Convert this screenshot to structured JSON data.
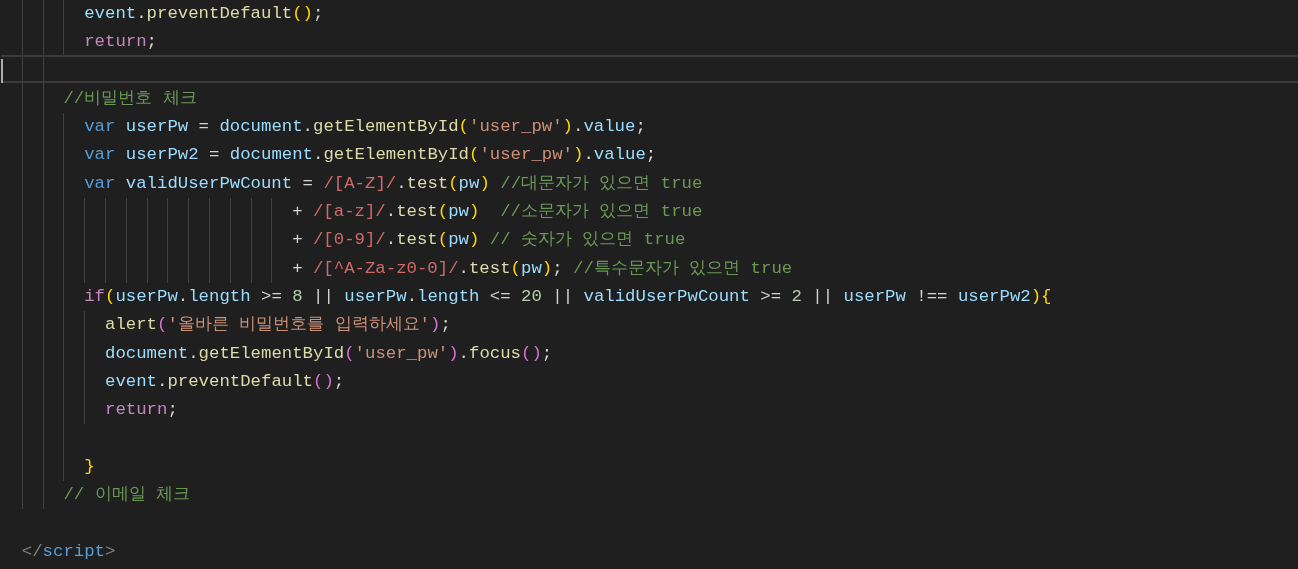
{
  "editor": {
    "lines": [
      {
        "current": false,
        "tokens": [
          {
            "text": "        event",
            "kind": "variable"
          },
          {
            "text": ".",
            "kind": "plain"
          },
          {
            "text": "preventDefault",
            "kind": "function"
          },
          {
            "text": "()",
            "kind": "bracket"
          },
          {
            "text": ";",
            "kind": "plain"
          }
        ]
      },
      {
        "current": false,
        "tokens": [
          {
            "text": "        return",
            "kind": "control"
          },
          {
            "text": ";",
            "kind": "plain"
          }
        ]
      },
      {
        "current": true
      },
      {
        "current": false,
        "tokens": [
          {
            "text": "      //비밀번호 체크",
            "kind": "comment"
          }
        ]
      },
      {
        "current": false,
        "tokens": [
          {
            "text": "        var",
            "kind": "keyword"
          },
          {
            "text": " userPw ",
            "kind": "variable"
          },
          {
            "text": "= ",
            "kind": "plain"
          },
          {
            "text": "document",
            "kind": "variable"
          },
          {
            "text": ".",
            "kind": "plain"
          },
          {
            "text": "getElementById",
            "kind": "function"
          },
          {
            "text": "(",
            "kind": "bracket"
          },
          {
            "text": "'user_pw'",
            "kind": "string"
          },
          {
            "text": ")",
            "kind": "bracket"
          },
          {
            "text": ".",
            "kind": "plain"
          },
          {
            "text": "value",
            "kind": "variable"
          },
          {
            "text": ";",
            "kind": "plain"
          }
        ]
      },
      {
        "current": false,
        "tokens": [
          {
            "text": "        var",
            "kind": "keyword"
          },
          {
            "text": " userPw2 ",
            "kind": "variable"
          },
          {
            "text": "= ",
            "kind": "plain"
          },
          {
            "text": "document",
            "kind": "variable"
          },
          {
            "text": ".",
            "kind": "plain"
          },
          {
            "text": "getElementById",
            "kind": "function"
          },
          {
            "text": "(",
            "kind": "bracket"
          },
          {
            "text": "'user_pw'",
            "kind": "string"
          },
          {
            "text": ")",
            "kind": "bracket"
          },
          {
            "text": ".",
            "kind": "plain"
          },
          {
            "text": "value",
            "kind": "variable"
          },
          {
            "text": ";",
            "kind": "plain"
          }
        ]
      },
      {
        "current": false,
        "tokens": [
          {
            "text": "        var",
            "kind": "keyword"
          },
          {
            "text": " validUserPwCount ",
            "kind": "variable"
          },
          {
            "text": "= ",
            "kind": "plain"
          },
          {
            "text": "/[A-Z]/",
            "kind": "regex"
          },
          {
            "text": ".",
            "kind": "plain"
          },
          {
            "text": "test",
            "kind": "function"
          },
          {
            "text": "(",
            "kind": "bracket"
          },
          {
            "text": "pw",
            "kind": "variable"
          },
          {
            "text": ")",
            "kind": "bracket"
          },
          {
            "text": " //대문자가 있으면 true",
            "kind": "comment"
          }
        ]
      },
      {
        "current": false,
        "tokens": [
          {
            "text": "                            + ",
            "kind": "plain"
          },
          {
            "text": "/[a-z]/",
            "kind": "regex"
          },
          {
            "text": ".",
            "kind": "plain"
          },
          {
            "text": "test",
            "kind": "function"
          },
          {
            "text": "(",
            "kind": "bracket"
          },
          {
            "text": "pw",
            "kind": "variable"
          },
          {
            "text": ")",
            "kind": "bracket"
          },
          {
            "text": "  //소문자가 있으면 true",
            "kind": "comment"
          }
        ]
      },
      {
        "current": false,
        "tokens": [
          {
            "text": "                            + ",
            "kind": "plain"
          },
          {
            "text": "/[0-9]/",
            "kind": "regex"
          },
          {
            "text": ".",
            "kind": "plain"
          },
          {
            "text": "test",
            "kind": "function"
          },
          {
            "text": "(",
            "kind": "bracket"
          },
          {
            "text": "pw",
            "kind": "variable"
          },
          {
            "text": ")",
            "kind": "bracket"
          },
          {
            "text": " // 숫자가 있으면 true",
            "kind": "comment"
          }
        ]
      },
      {
        "current": false,
        "tokens": [
          {
            "text": "                            + ",
            "kind": "plain"
          },
          {
            "text": "/[^A-Za-z0-0]/",
            "kind": "regex"
          },
          {
            "text": ".",
            "kind": "plain"
          },
          {
            "text": "test",
            "kind": "function"
          },
          {
            "text": "(",
            "kind": "bracket"
          },
          {
            "text": "pw",
            "kind": "variable"
          },
          {
            "text": ")",
            "kind": "bracket"
          },
          {
            "text": "; ",
            "kind": "plain"
          },
          {
            "text": "//특수문자가 있으면 true",
            "kind": "comment"
          }
        ]
      },
      {
        "current": false,
        "tokens": [
          {
            "text": "        if",
            "kind": "control"
          },
          {
            "text": "(",
            "kind": "bracket"
          },
          {
            "text": "userPw",
            "kind": "variable"
          },
          {
            "text": ".",
            "kind": "plain"
          },
          {
            "text": "length",
            "kind": "variable"
          },
          {
            "text": " >= ",
            "kind": "plain"
          },
          {
            "text": "8",
            "kind": "number"
          },
          {
            "text": " || ",
            "kind": "plain"
          },
          {
            "text": "userPw",
            "kind": "variable"
          },
          {
            "text": ".",
            "kind": "plain"
          },
          {
            "text": "length",
            "kind": "variable"
          },
          {
            "text": " <= ",
            "kind": "plain"
          },
          {
            "text": "20",
            "kind": "number"
          },
          {
            "text": " || ",
            "kind": "plain"
          },
          {
            "text": "validUserPwCount",
            "kind": "variable"
          },
          {
            "text": " >= ",
            "kind": "plain"
          },
          {
            "text": "2",
            "kind": "number"
          },
          {
            "text": " || ",
            "kind": "plain"
          },
          {
            "text": "userPw",
            "kind": "variable"
          },
          {
            "text": " !== ",
            "kind": "plain"
          },
          {
            "text": "userPw2",
            "kind": "variable"
          },
          {
            "text": "){",
            "kind": "bracket"
          }
        ]
      },
      {
        "current": false,
        "tokens": [
          {
            "text": "          alert",
            "kind": "function"
          },
          {
            "text": "(",
            "kind": "bracket2"
          },
          {
            "text": "'올바른 비밀번호를 입력하세요'",
            "kind": "string"
          },
          {
            "text": ")",
            "kind": "bracket2"
          },
          {
            "text": ";",
            "kind": "plain"
          }
        ]
      },
      {
        "current": false,
        "tokens": [
          {
            "text": "          document",
            "kind": "variable"
          },
          {
            "text": ".",
            "kind": "plain"
          },
          {
            "text": "getElementById",
            "kind": "function"
          },
          {
            "text": "(",
            "kind": "bracket2"
          },
          {
            "text": "'user_pw'",
            "kind": "string"
          },
          {
            "text": ")",
            "kind": "bracket2"
          },
          {
            "text": ".",
            "kind": "plain"
          },
          {
            "text": "focus",
            "kind": "function"
          },
          {
            "text": "()",
            "kind": "bracket2"
          },
          {
            "text": ";",
            "kind": "plain"
          }
        ]
      },
      {
        "current": false,
        "tokens": [
          {
            "text": "          event",
            "kind": "variable"
          },
          {
            "text": ".",
            "kind": "plain"
          },
          {
            "text": "preventDefault",
            "kind": "function"
          },
          {
            "text": "()",
            "kind": "bracket2"
          },
          {
            "text": ";",
            "kind": "plain"
          }
        ]
      },
      {
        "current": false,
        "tokens": [
          {
            "text": "          return",
            "kind": "control"
          },
          {
            "text": ";",
            "kind": "plain"
          }
        ]
      },
      {
        "current": false
      },
      {
        "current": false,
        "tokens": [
          {
            "text": "        }",
            "kind": "bracket"
          }
        ]
      },
      {
        "current": false,
        "tokens": [
          {
            "text": "      // 이메일 체크",
            "kind": "comment"
          }
        ]
      },
      {
        "current": false
      },
      {
        "current": false,
        "tokens": [
          {
            "text": "  </",
            "kind": "tag"
          },
          {
            "text": "script",
            "kind": "tagname"
          },
          {
            "text": ">",
            "kind": "tag"
          }
        ]
      }
    ]
  }
}
